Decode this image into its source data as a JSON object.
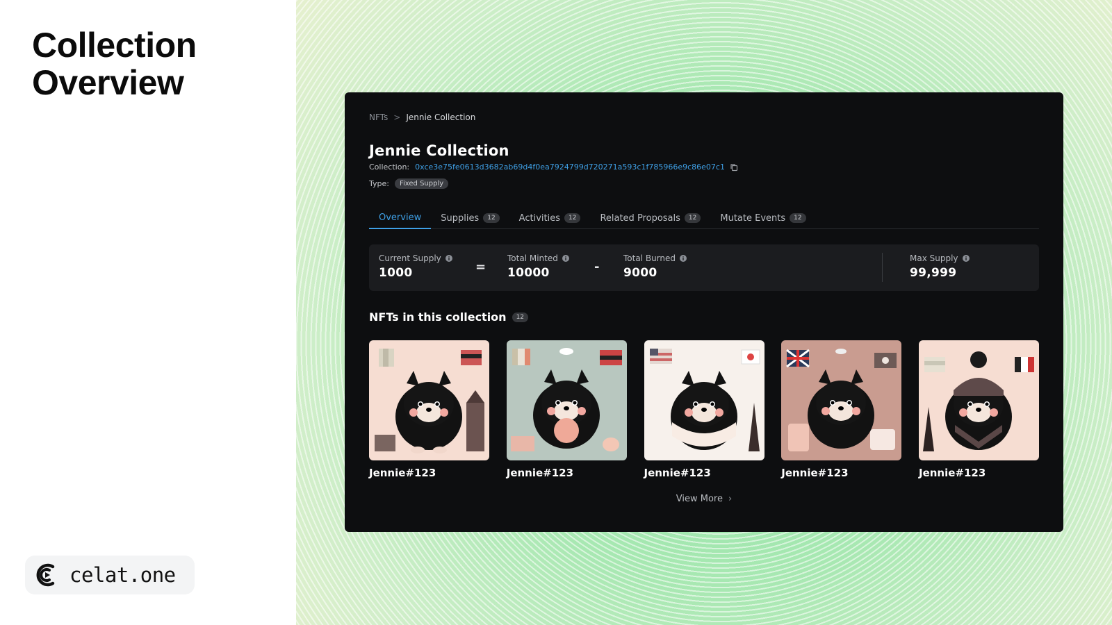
{
  "slide": {
    "title_line1": "Collection",
    "title_line2": "Overview",
    "brand_name": "celat.one"
  },
  "app": {
    "breadcrumb": {
      "parent": "NFTs",
      "separator": ">",
      "current": "Jennie Collection"
    },
    "title": "Jennie Collection",
    "collection_label": "Collection:",
    "collection_address": "0xce3e75fe0613d3682ab69d4f0ea7924799d720271a593c1f785966e9c86e07c1",
    "type_label": "Type:",
    "type_value": "Fixed Supply",
    "tabs": [
      {
        "label": "Overview",
        "count": "",
        "active": true
      },
      {
        "label": "Supplies",
        "count": "12",
        "active": false
      },
      {
        "label": "Activities",
        "count": "12",
        "active": false
      },
      {
        "label": "Related Proposals",
        "count": "12",
        "active": false
      },
      {
        "label": "Mutate Events",
        "count": "12",
        "active": false
      }
    ],
    "supply": {
      "current": {
        "label": "Current Supply",
        "value": "1000"
      },
      "equals": "=",
      "minted": {
        "label": "Total Minted",
        "value": "10000"
      },
      "minus": "-",
      "burned": {
        "label": "Total Burned",
        "value": "9000"
      },
      "max": {
        "label": "Max Supply",
        "value": "99,999"
      }
    },
    "nfts_section": {
      "title": "NFTs in this collection",
      "count": "12"
    },
    "nfts": [
      {
        "name": "Jennie#123",
        "bg": "#f6ddd2"
      },
      {
        "name": "Jennie#123",
        "bg": "#b8c7bf"
      },
      {
        "name": "Jennie#123",
        "bg": "#f7f1ec"
      },
      {
        "name": "Jennie#123",
        "bg": "#c99c90"
      },
      {
        "name": "Jennie#123",
        "bg": "#f6ddd2"
      }
    ],
    "view_more": "View More"
  },
  "colors": {
    "accent": "#3fa0e6",
    "window_bg": "#0d0e10",
    "card_bg": "#1b1c1f"
  }
}
